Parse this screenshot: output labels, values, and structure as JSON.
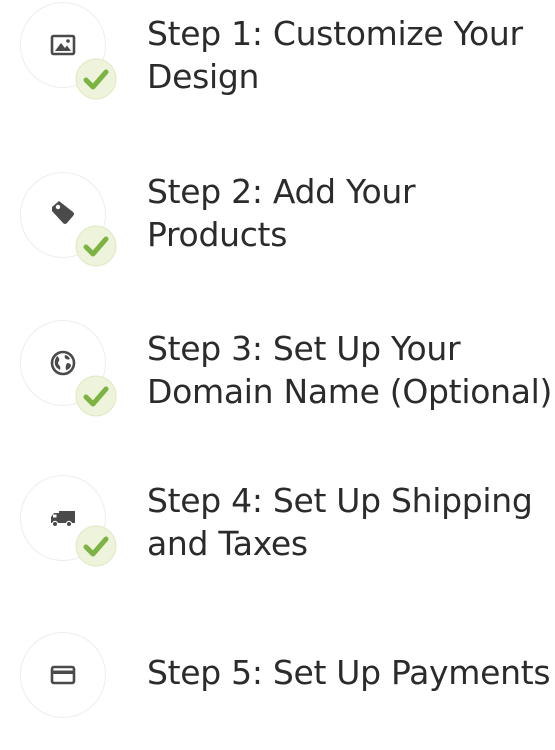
{
  "steps": [
    {
      "line1": "Step 1: Customize Your",
      "line2": "Design",
      "icon": "image-icon",
      "completed": true
    },
    {
      "line1": "Step 2: Add Your",
      "line2": "Products",
      "icon": "tag-icon",
      "completed": true
    },
    {
      "line1": "Step 3: Set Up Your",
      "line2": "Domain Name (Optional)",
      "icon": "globe-icon",
      "completed": true
    },
    {
      "line1": "Step 4: Set Up Shipping",
      "line2": "and Taxes",
      "icon": "truck-icon",
      "completed": true
    },
    {
      "line1": "Step 5: Set Up Payments",
      "line2": "",
      "icon": "credit-card-icon",
      "completed": false
    }
  ],
  "colors": {
    "check_fill": "#eef4dc",
    "check_mark": "#7cb342",
    "icon": "#4a4a4a",
    "circle_border": "#ededed"
  }
}
